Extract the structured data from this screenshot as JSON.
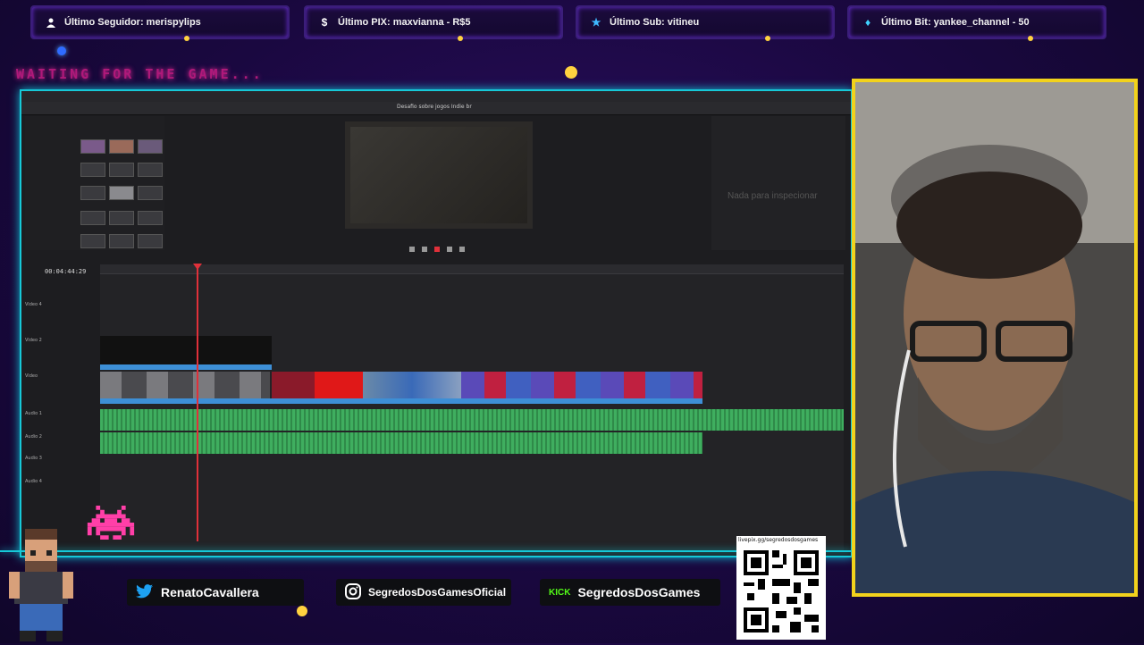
{
  "alerts": [
    {
      "icon": "user-icon",
      "label": "Último Seguidor: merispylips"
    },
    {
      "icon": "dollar-icon",
      "label": "Último PIX: maxvianna - R$5"
    },
    {
      "icon": "star-icon",
      "label": "Último Sub: vitineu"
    },
    {
      "icon": "diamond-icon",
      "label": "Último Bit: yankee_channel - 50"
    }
  ],
  "waiting_text": "WAITING FOR THE GAME...",
  "editor": {
    "project_title": "Desafio sobre jogos Indie br",
    "timecode": "00:04:44:29",
    "inspector_empty": "Nada para inspecionar",
    "tracks": [
      {
        "name": "Video 4"
      },
      {
        "name": "Video 2"
      },
      {
        "name": "Video"
      },
      {
        "name": "Audio 1"
      },
      {
        "name": "Audio 2"
      },
      {
        "name": "Audio 3"
      },
      {
        "name": "Audio 4"
      }
    ]
  },
  "socials": {
    "twitter": "RenatoCavallera",
    "instagram": "SegredosDosGamesOficial",
    "kick_brand": "KICK",
    "kick": "SegredosDosGames"
  },
  "qr": {
    "url": "livepix.gg/segredosdosgames"
  },
  "colors": {
    "accent_cyan": "#16c9d8",
    "webcam_border": "#f2d21c",
    "audio_green": "#3fae5f",
    "playhead_red": "#e0303a"
  }
}
